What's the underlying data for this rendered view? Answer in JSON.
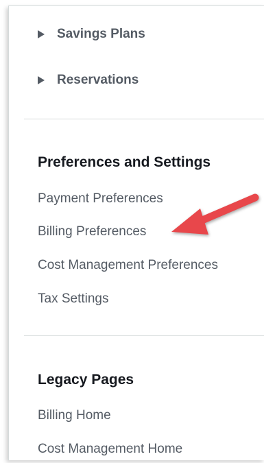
{
  "expandables": [
    {
      "label": "Savings Plans",
      "icon": "caret-right-icon"
    },
    {
      "label": "Reservations",
      "icon": "caret-right-icon"
    }
  ],
  "preferences": {
    "heading": "Preferences and Settings",
    "links": [
      {
        "label": "Payment Preferences"
      },
      {
        "label": "Billing Preferences"
      },
      {
        "label": "Cost Management Preferences"
      },
      {
        "label": "Tax Settings"
      }
    ]
  },
  "legacy": {
    "heading": "Legacy Pages",
    "links": [
      {
        "label": "Billing Home"
      },
      {
        "label": "Cost Management Home"
      }
    ]
  },
  "annotation": {
    "arrow_color": "#e8474b"
  }
}
